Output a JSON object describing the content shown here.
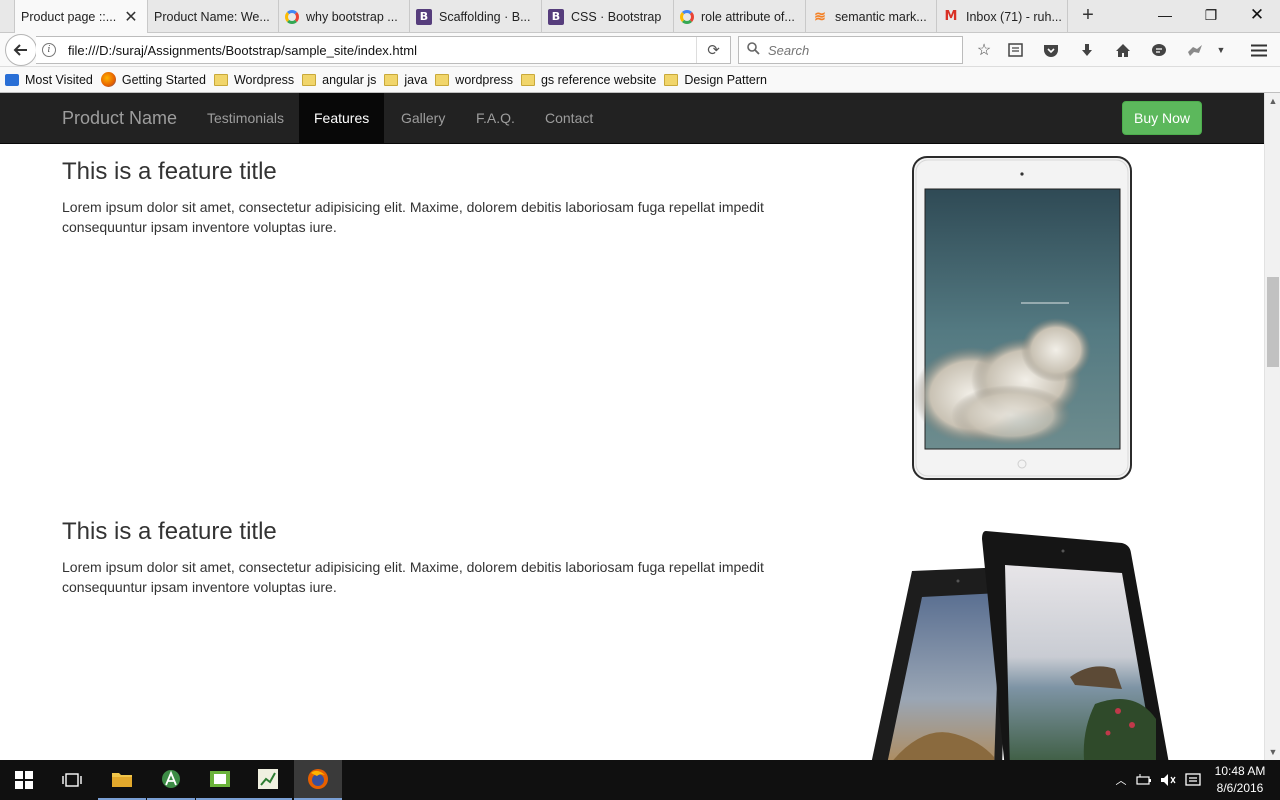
{
  "browser": {
    "tabs": [
      {
        "label": "Product page ::...",
        "icon": "page-icon",
        "active": true
      },
      {
        "label": "Product Name: We...",
        "icon": "page-icon"
      },
      {
        "label": "why bootstrap ...",
        "icon": "google-icon"
      },
      {
        "label": "Scaffolding · B...",
        "icon": "bootstrap-icon"
      },
      {
        "label": "CSS · Bootstrap",
        "icon": "bootstrap-icon"
      },
      {
        "label": "role attribute of...",
        "icon": "google-icon"
      },
      {
        "label": "semantic mark...",
        "icon": "stackoverflow-icon"
      },
      {
        "label": "Inbox (71) - ruh...",
        "icon": "gmail-icon"
      }
    ],
    "url": "file:///D:/suraj/Assignments/Bootstrap/sample_site/index.html",
    "search_placeholder": "Search",
    "bookmarks": [
      {
        "label": "Most Visited",
        "icon": "most-visited-icon"
      },
      {
        "label": "Getting Started",
        "icon": "firefox-icon"
      },
      {
        "label": "Wordpress",
        "icon": "folder-icon"
      },
      {
        "label": "angular js",
        "icon": "folder-icon"
      },
      {
        "label": "java",
        "icon": "folder-icon"
      },
      {
        "label": "wordpress",
        "icon": "folder-icon"
      },
      {
        "label": "gs reference website",
        "icon": "folder-icon"
      },
      {
        "label": "Design Pattern",
        "icon": "folder-icon"
      }
    ]
  },
  "site": {
    "brand": "Product Name",
    "nav": [
      "Testimonials",
      "Features",
      "Gallery",
      "F.A.Q.",
      "Contact"
    ],
    "active_nav": "Features",
    "buy_label": "Buy Now",
    "features": [
      {
        "title": "This is a feature title",
        "body": "Lorem ipsum dolor sit amet, consectetur adipisicing elit. Maxime, dolorem debitis laboriosam fuga repellat impedit consequuntur ipsam inventore voluptas iure."
      },
      {
        "title": "This is a feature title",
        "body": "Lorem ipsum dolor sit amet, consectetur adipisicing elit. Maxime, dolorem debitis laboriosam fuga repellat impedit consequuntur ipsam inventore voluptas iure."
      }
    ]
  },
  "taskbar": {
    "time": "10:48 AM",
    "date": "8/6/2016"
  },
  "colors": {
    "navbar_bg": "#222222",
    "buy_button": "#5cb85c"
  }
}
